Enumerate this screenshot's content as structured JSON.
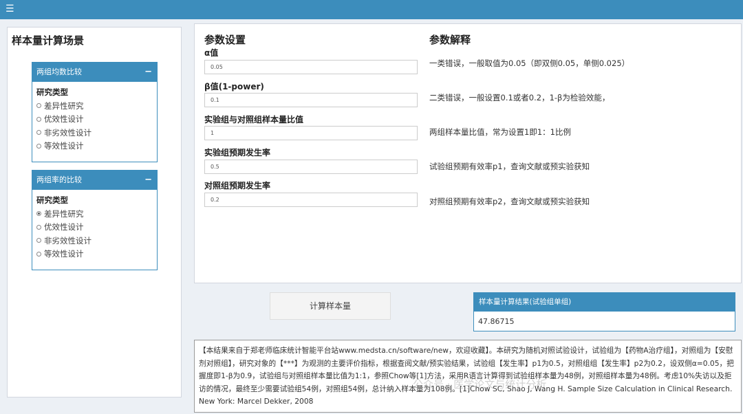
{
  "menu_icon": "hamburger-icon",
  "left": {
    "title": "样本量计算场景",
    "box1": {
      "header": "两组均数比较",
      "collapse": "−",
      "radio_title": "研究类型",
      "options": [
        "差异性研究",
        "优效性设计",
        "非劣效性设计",
        "等效性设计"
      ],
      "selected_index": -1
    },
    "box2": {
      "header": "两组率的比较",
      "collapse": "−",
      "radio_title": "研究类型",
      "options": [
        "差异性研究",
        "优效性设计",
        "非劣效性设计",
        "等效性设计"
      ],
      "selected_index": 0
    }
  },
  "params": {
    "title": "参数设置",
    "fields": [
      {
        "label": "α值",
        "value": "0.05"
      },
      {
        "label": "β值(1-power)",
        "value": "0.1"
      },
      {
        "label": "实验组与对照组样本量比值",
        "value": "1"
      },
      {
        "label": "实验组预期发生率",
        "value": "0.5"
      },
      {
        "label": "对照组预期发生率",
        "value": "0.2"
      }
    ]
  },
  "explanation": {
    "title": "参数解释",
    "lines": [
      "一类错误，一般取值为0.05（即双侧0.05，单侧0.025）",
      "二类错误，一般设置0.1或者0.2，1-β为检验效能，",
      "两组样本量比值，常为设置1即1：1比例",
      "试验组预期有效率p1，查询文献或预实验获知",
      "对照组预期有效率p2，查询文献或预实验获知"
    ]
  },
  "calc_button": "计算样本量",
  "result": {
    "header": "样本量计算结果(试验组单组)",
    "value": "47.86715"
  },
  "summary": "【本结果来自于郑老师临床统计智能平台站www.medsta.cn/software/new，欢迎收藏】。本研究为随机对照试验设计，试验组为【药物A治疗组】，对照组为【安慰剂对照组】，研究对象的【***】为观测的主要评价指标，根据查阅文献/预实验结果，试验组【发生率】p1为0.5，对照组组【发生率】p2为0.2，设双侧α=0.05，把握度即1-β为0.9，试验组与对照组样本量比值为1:1，参照Chow等[1]方法，采用R语言计算得到试验组样本量为48例，对照组样本量为48例。考虑10%失访以及拒访的情况，最终至少需要试验组54例，对照组54例，总计纳入样本量为108例。[1]Chow SC, Shao J, Wang H. Sample Size Calculation in Clinical Research. New York: Marcel Dekker, 2008",
  "watermark": "公众号 · 医学论文与统计分析"
}
